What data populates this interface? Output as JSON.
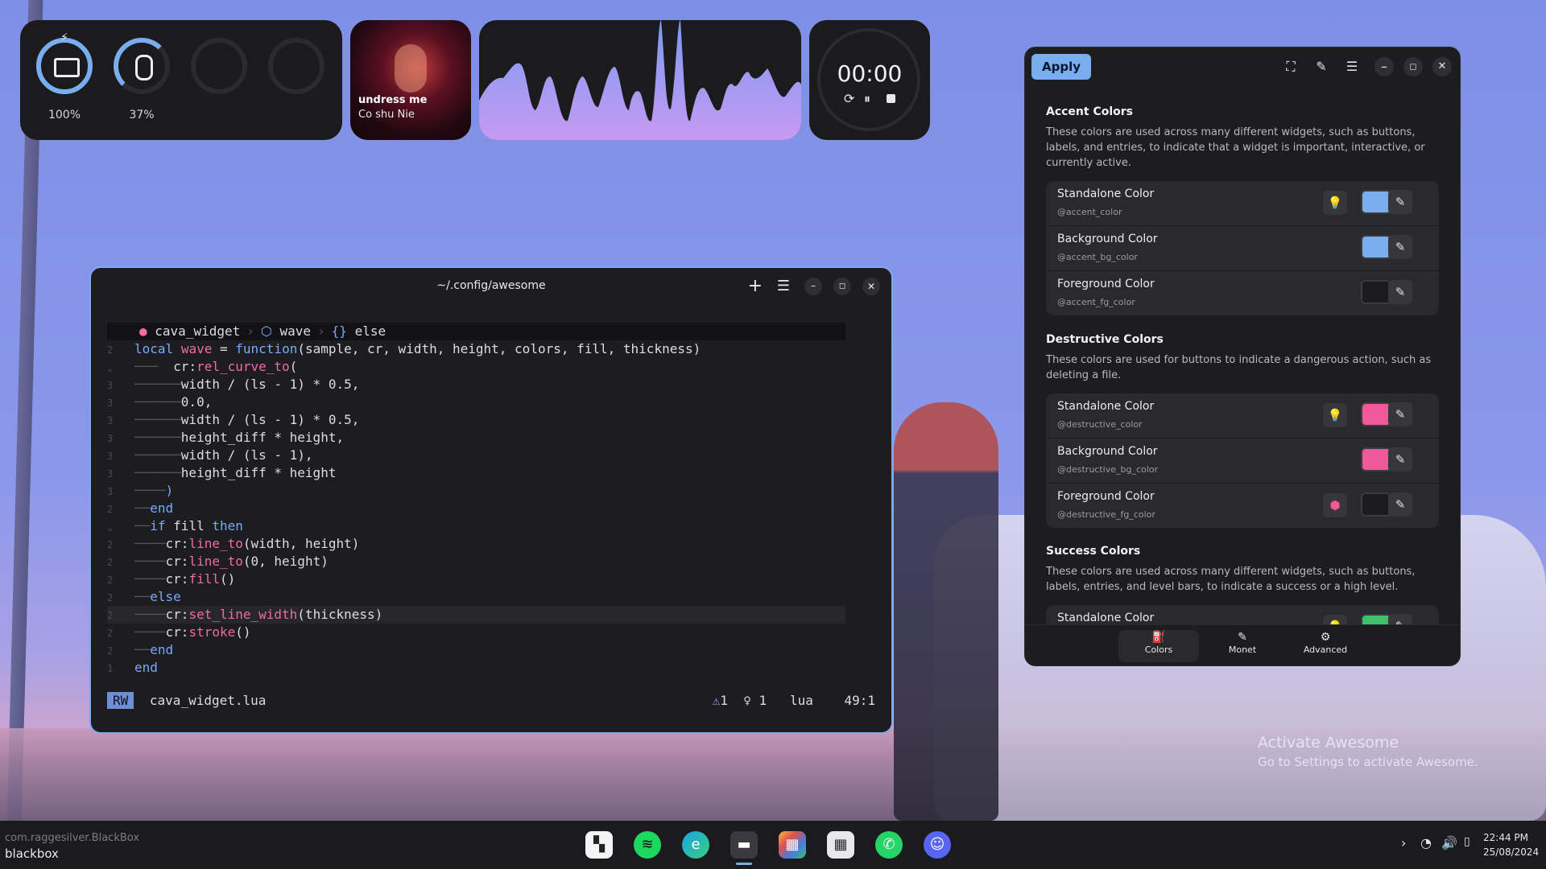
{
  "widgets": {
    "battery": {
      "percent": "100%"
    },
    "mouse": {
      "percent": "37%"
    },
    "media": {
      "title": "undress me",
      "artist": "Co shu Nie"
    },
    "timer": {
      "time": "00:00"
    }
  },
  "terminal": {
    "title": "~/.config/awesome",
    "breadcrumbs": [
      "cava_widget",
      "wave",
      "else"
    ],
    "status": {
      "mode": "RW",
      "file": "cava_widget.lua",
      "warnings": "1",
      "hints": "1",
      "lang": "lua",
      "pos": "49:1"
    }
  },
  "prefs": {
    "apply_label": "Apply",
    "sections": [
      {
        "title": "Accent Colors",
        "desc": "These colors are used across many different widgets, such as buttons, labels, and entries, to indicate that a widget is important, interactive, or currently active.",
        "rows": [
          {
            "title": "Standalone Color",
            "var": "@accent_color",
            "color": "#78aeed"
          },
          {
            "title": "Background Color",
            "var": "@accent_bg_color",
            "color": "#78aeed"
          },
          {
            "title": "Foreground Color",
            "var": "@accent_fg_color",
            "color": "#1b1b1d"
          }
        ]
      },
      {
        "title": "Destructive Colors",
        "desc": "These colors are used for buttons to indicate a dangerous action, such as deleting a file.",
        "rows": [
          {
            "title": "Standalone Color",
            "var": "@destructive_color",
            "color": "#f0589a"
          },
          {
            "title": "Background Color",
            "var": "@destructive_bg_color",
            "color": "#f0589a"
          },
          {
            "title": "Foreground Color",
            "var": "@destructive_fg_color",
            "color": "#1b1b1d"
          }
        ]
      },
      {
        "title": "Success Colors",
        "desc": "These colors are used across many different widgets, such as buttons, labels, entries, and level bars, to indicate a success or a high level.",
        "rows": [
          {
            "title": "Standalone Color",
            "var": "",
            "color": "#3fc06b"
          }
        ]
      }
    ],
    "tabs": [
      {
        "label": "Colors",
        "icon": "paint-bucket-icon"
      },
      {
        "label": "Monet",
        "icon": "brush-icon"
      },
      {
        "label": "Advanced",
        "icon": "gear-icon"
      }
    ]
  },
  "watermark": {
    "line1": "Activate Awesome",
    "line2": "Go to Settings to activate Awesome."
  },
  "taskbar": {
    "app_id": "com.raggesilver.BlackBox",
    "app_name": "blackbox",
    "time": "22:44 PM",
    "date": "25/08/2024"
  }
}
